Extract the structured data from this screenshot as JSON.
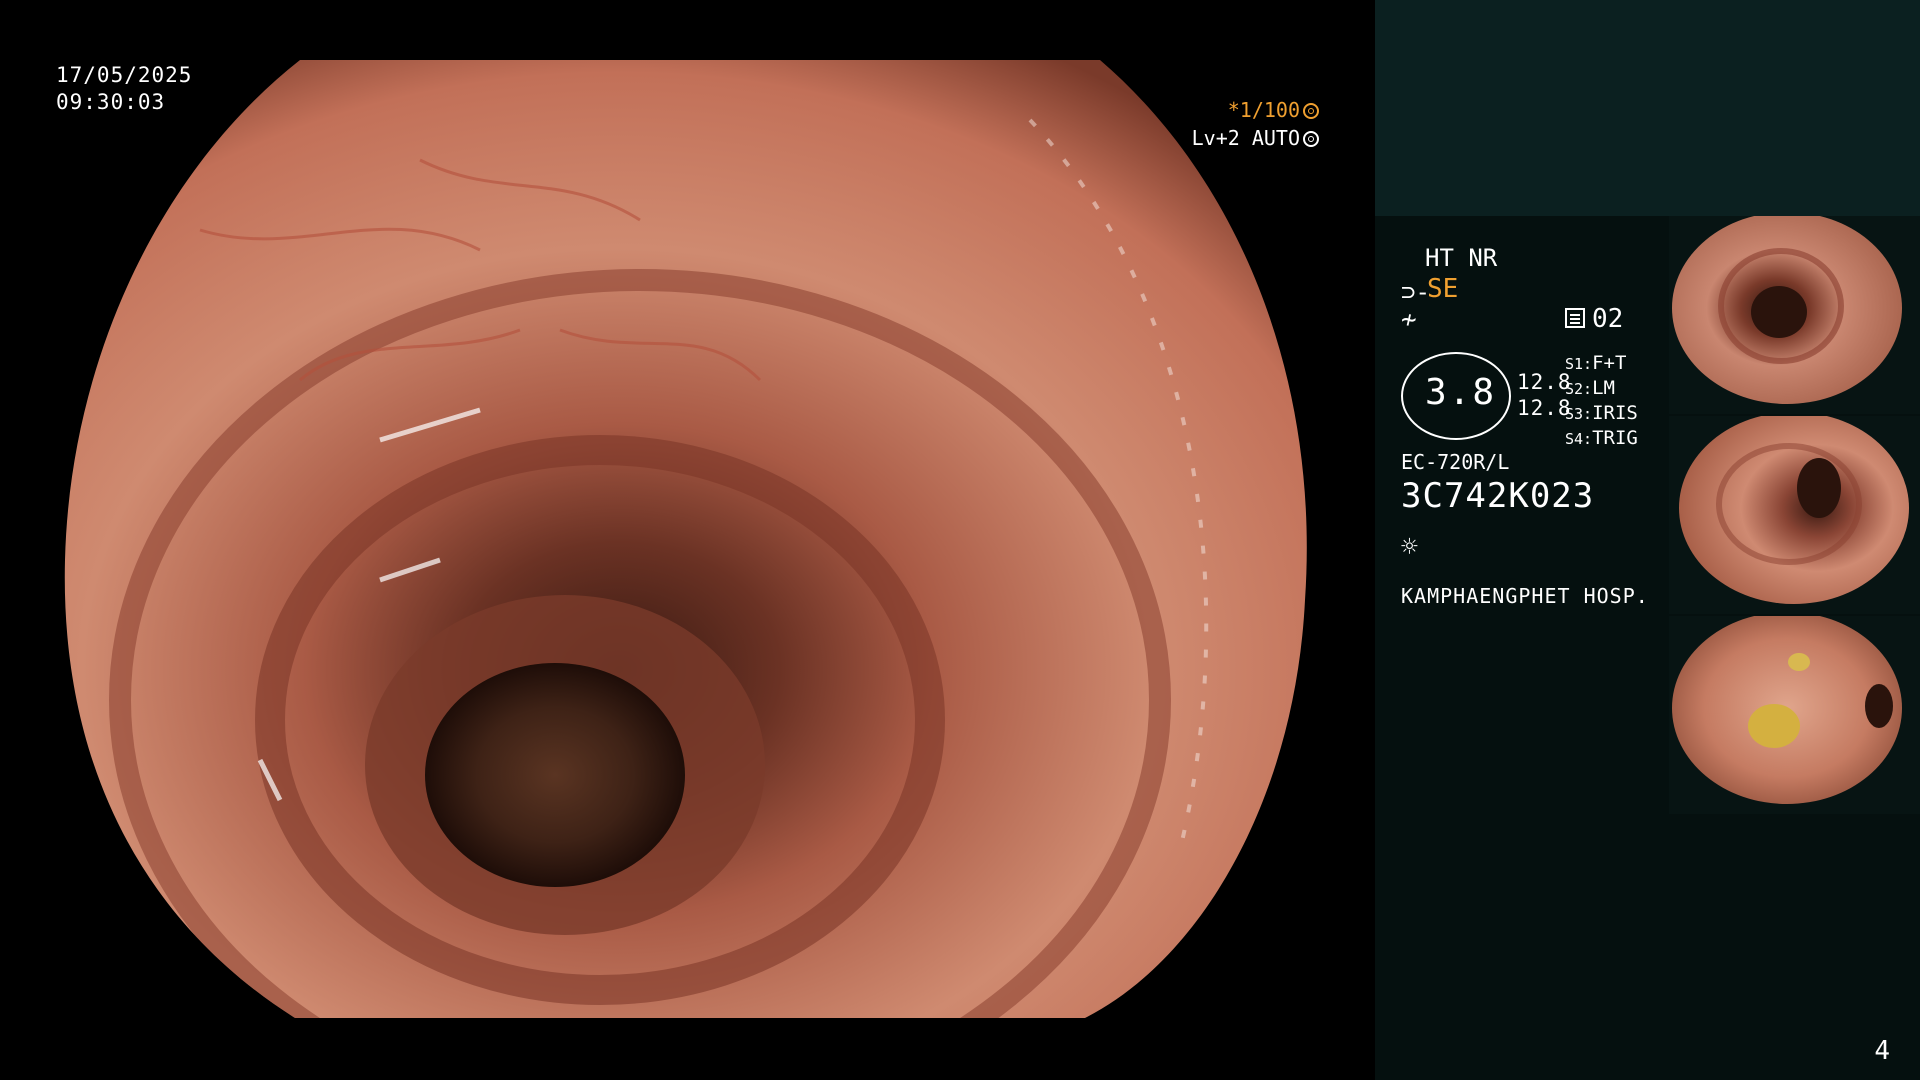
{
  "overlay": {
    "date": "17/05/2025",
    "time": "09:30:03",
    "shutter": "*1/100",
    "level": "Lv+2 AUTO"
  },
  "icons": {
    "shutter": "aperture-icon",
    "level": "auto-iris-icon",
    "structure_enhance": "structure-enhance-icon",
    "enhancement": "edge-enhance-icon",
    "mode": "memory-icon",
    "light": "light-source-icon"
  },
  "panel": {
    "ht_nr": "HT NR",
    "se": "SE",
    "mode_value": "02",
    "gauge_value": "3.8",
    "gauge_left": "12.8",
    "gauge_right": "12.8",
    "switches": [
      {
        "key": "S1:",
        "value": "F+T"
      },
      {
        "key": "S2:",
        "value": "LM"
      },
      {
        "key": "S3:",
        "value": "IRIS"
      },
      {
        "key": "S4:",
        "value": "TRIG"
      }
    ],
    "scope_model": "EC-720R/L",
    "scope_serial": "3C742K023",
    "hospital": "KAMPHAENGPHET HOSP."
  },
  "page_number": "4",
  "colors": {
    "accent": "#f0a030",
    "panel_bg": "#05100f",
    "panel_top": "#0b2020",
    "mucosa": "#c77a62"
  }
}
